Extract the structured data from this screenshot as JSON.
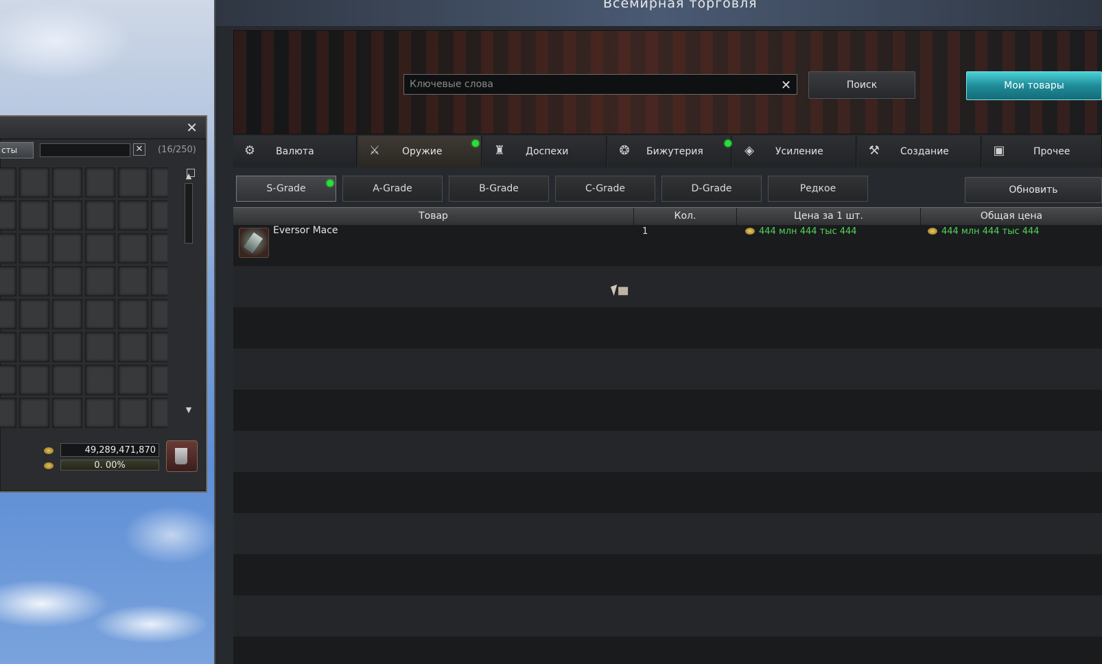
{
  "inventory": {
    "tab_label": "сты",
    "count": "(16/250)",
    "adena": "49,289,471,870",
    "weight": "0. 00%",
    "close_glyph": "✕",
    "clear_glyph": "✕"
  },
  "window": {
    "title": "Всемирная торговля"
  },
  "search": {
    "placeholder": "Ключевые слова",
    "clear_glyph": "✕",
    "button": "Поиск",
    "my_items": "Мои товары"
  },
  "categories": [
    {
      "label": "Валюта",
      "icon": "coins-icon",
      "dot": false
    },
    {
      "label": "Оружие",
      "icon": "weapon-icon",
      "dot": true
    },
    {
      "label": "Доспехи",
      "icon": "helmet-icon",
      "dot": false
    },
    {
      "label": "Бижутерия",
      "icon": "jewelry-icon",
      "dot": true
    },
    {
      "label": "Усиление",
      "icon": "enhance-icon",
      "dot": false
    },
    {
      "label": "Создание",
      "icon": "craft-icon",
      "dot": false
    },
    {
      "label": "Прочее",
      "icon": "box-icon",
      "dot": false
    }
  ],
  "grades": [
    "S-Grade",
    "A-Grade",
    "B-Grade",
    "C-Grade",
    "D-Grade",
    "Редкое"
  ],
  "refresh": "Обновить",
  "table": {
    "headers": [
      "Товар",
      "Кол.",
      "Цена за 1 шт.",
      "Общая цена"
    ],
    "rows": [
      {
        "name": "Eversor Mace",
        "qty": "1",
        "unit_price": "444 млн 444 тыс 444",
        "total_price": "444 млн 444 тыс 444"
      }
    ]
  },
  "colors": {
    "accent": "#1e8c99",
    "price": "#52d45a",
    "new_dot": "#27e03a"
  }
}
